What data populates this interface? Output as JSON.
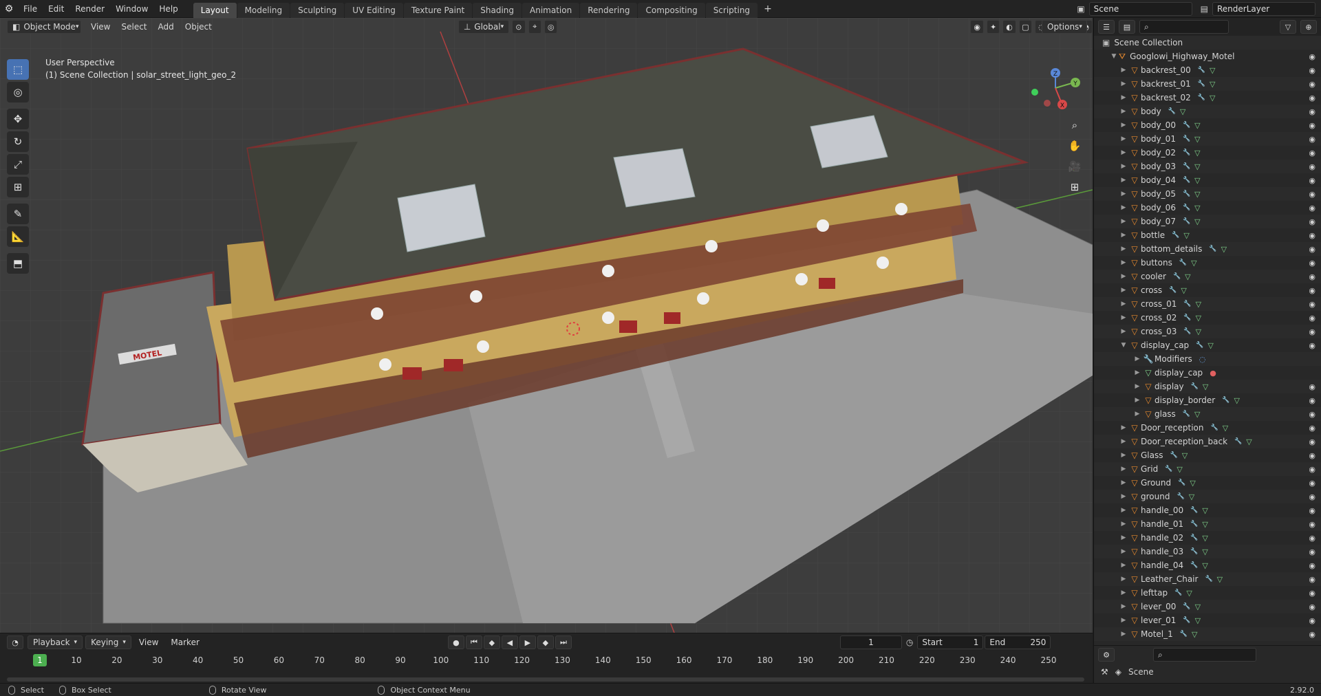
{
  "topbar": {
    "menus": [
      "File",
      "Edit",
      "Render",
      "Window",
      "Help"
    ],
    "workspaces": [
      "Layout",
      "Modeling",
      "Sculpting",
      "UV Editing",
      "Texture Paint",
      "Shading",
      "Animation",
      "Rendering",
      "Compositing",
      "Scripting"
    ],
    "active_workspace": "Layout",
    "add_tab": "+",
    "scene": "Scene",
    "view_layer": "RenderLayer"
  },
  "viewport": {
    "mode": "Object Mode",
    "menus": [
      "View",
      "Select",
      "Add",
      "Object"
    ],
    "orientation": "Global",
    "options": "Options",
    "view_name": "User Perspective",
    "collection_info": "(1) Scene Collection | solar_street_light_geo_2",
    "sign_text": "MOTEL",
    "gizmo": {
      "x": "X",
      "y": "Y",
      "z": "Z"
    }
  },
  "outliner": {
    "search_placeholder": "",
    "root": "Scene Collection",
    "collection": "Googlowi_Highway_Motel",
    "items": [
      {
        "name": "backrest_00",
        "depth": 0
      },
      {
        "name": "backrest_01",
        "depth": 0
      },
      {
        "name": "backrest_02",
        "depth": 0
      },
      {
        "name": "body",
        "depth": 0
      },
      {
        "name": "body_00",
        "depth": 0
      },
      {
        "name": "body_01",
        "depth": 0
      },
      {
        "name": "body_02",
        "depth": 0
      },
      {
        "name": "body_03",
        "depth": 0
      },
      {
        "name": "body_04",
        "depth": 0
      },
      {
        "name": "body_05",
        "depth": 0
      },
      {
        "name": "body_06",
        "depth": 0
      },
      {
        "name": "body_07",
        "depth": 0
      },
      {
        "name": "bottle",
        "depth": 0
      },
      {
        "name": "bottom_details",
        "depth": 0
      },
      {
        "name": "buttons",
        "depth": 0
      },
      {
        "name": "cooler",
        "depth": 0
      },
      {
        "name": "cross",
        "depth": 0
      },
      {
        "name": "cross_01",
        "depth": 0
      },
      {
        "name": "cross_02",
        "depth": 0
      },
      {
        "name": "cross_03",
        "depth": 0
      },
      {
        "name": "display_cap",
        "depth": 0,
        "expanded": true
      },
      {
        "name": "Modifiers",
        "depth": 1,
        "type": "modifiers"
      },
      {
        "name": "display_cap",
        "depth": 1,
        "type": "mesh"
      },
      {
        "name": "display",
        "depth": 1
      },
      {
        "name": "display_border",
        "depth": 1
      },
      {
        "name": "glass",
        "depth": 1
      },
      {
        "name": "Door_reception",
        "depth": 0
      },
      {
        "name": "Door_reception_back",
        "depth": 0
      },
      {
        "name": "Glass",
        "depth": 0
      },
      {
        "name": "Grid",
        "depth": 0
      },
      {
        "name": "Ground",
        "depth": 0
      },
      {
        "name": "ground",
        "depth": 0
      },
      {
        "name": "handle_00",
        "depth": 0
      },
      {
        "name": "handle_01",
        "depth": 0
      },
      {
        "name": "handle_02",
        "depth": 0
      },
      {
        "name": "handle_03",
        "depth": 0
      },
      {
        "name": "handle_04",
        "depth": 0
      },
      {
        "name": "Leather_Chair",
        "depth": 0
      },
      {
        "name": "lefttap",
        "depth": 0
      },
      {
        "name": "lever_00",
        "depth": 0
      },
      {
        "name": "lever_01",
        "depth": 0
      },
      {
        "name": "Motel_1",
        "depth": 0
      }
    ]
  },
  "properties": {
    "scene": "Scene",
    "version": "2.92.0"
  },
  "timeline": {
    "menus": [
      "Playback",
      "Keying",
      "View",
      "Marker"
    ],
    "current_frame": "1",
    "start_label": "Start",
    "start": "1",
    "end_label": "End",
    "end": "250",
    "ticks": [
      1,
      10,
      20,
      30,
      40,
      50,
      60,
      70,
      80,
      90,
      100,
      110,
      120,
      130,
      140,
      150,
      160,
      170,
      180,
      190,
      200,
      210,
      220,
      230,
      240,
      250
    ]
  },
  "statusbar": {
    "select": "Select",
    "box_select": "Box Select",
    "rotate": "Rotate View",
    "context": "Object Context Menu"
  },
  "colors": {
    "accent": "#4772b3",
    "object": "#e88a2e",
    "mesh": "#7fd08a",
    "playhead": "#4caf50"
  }
}
